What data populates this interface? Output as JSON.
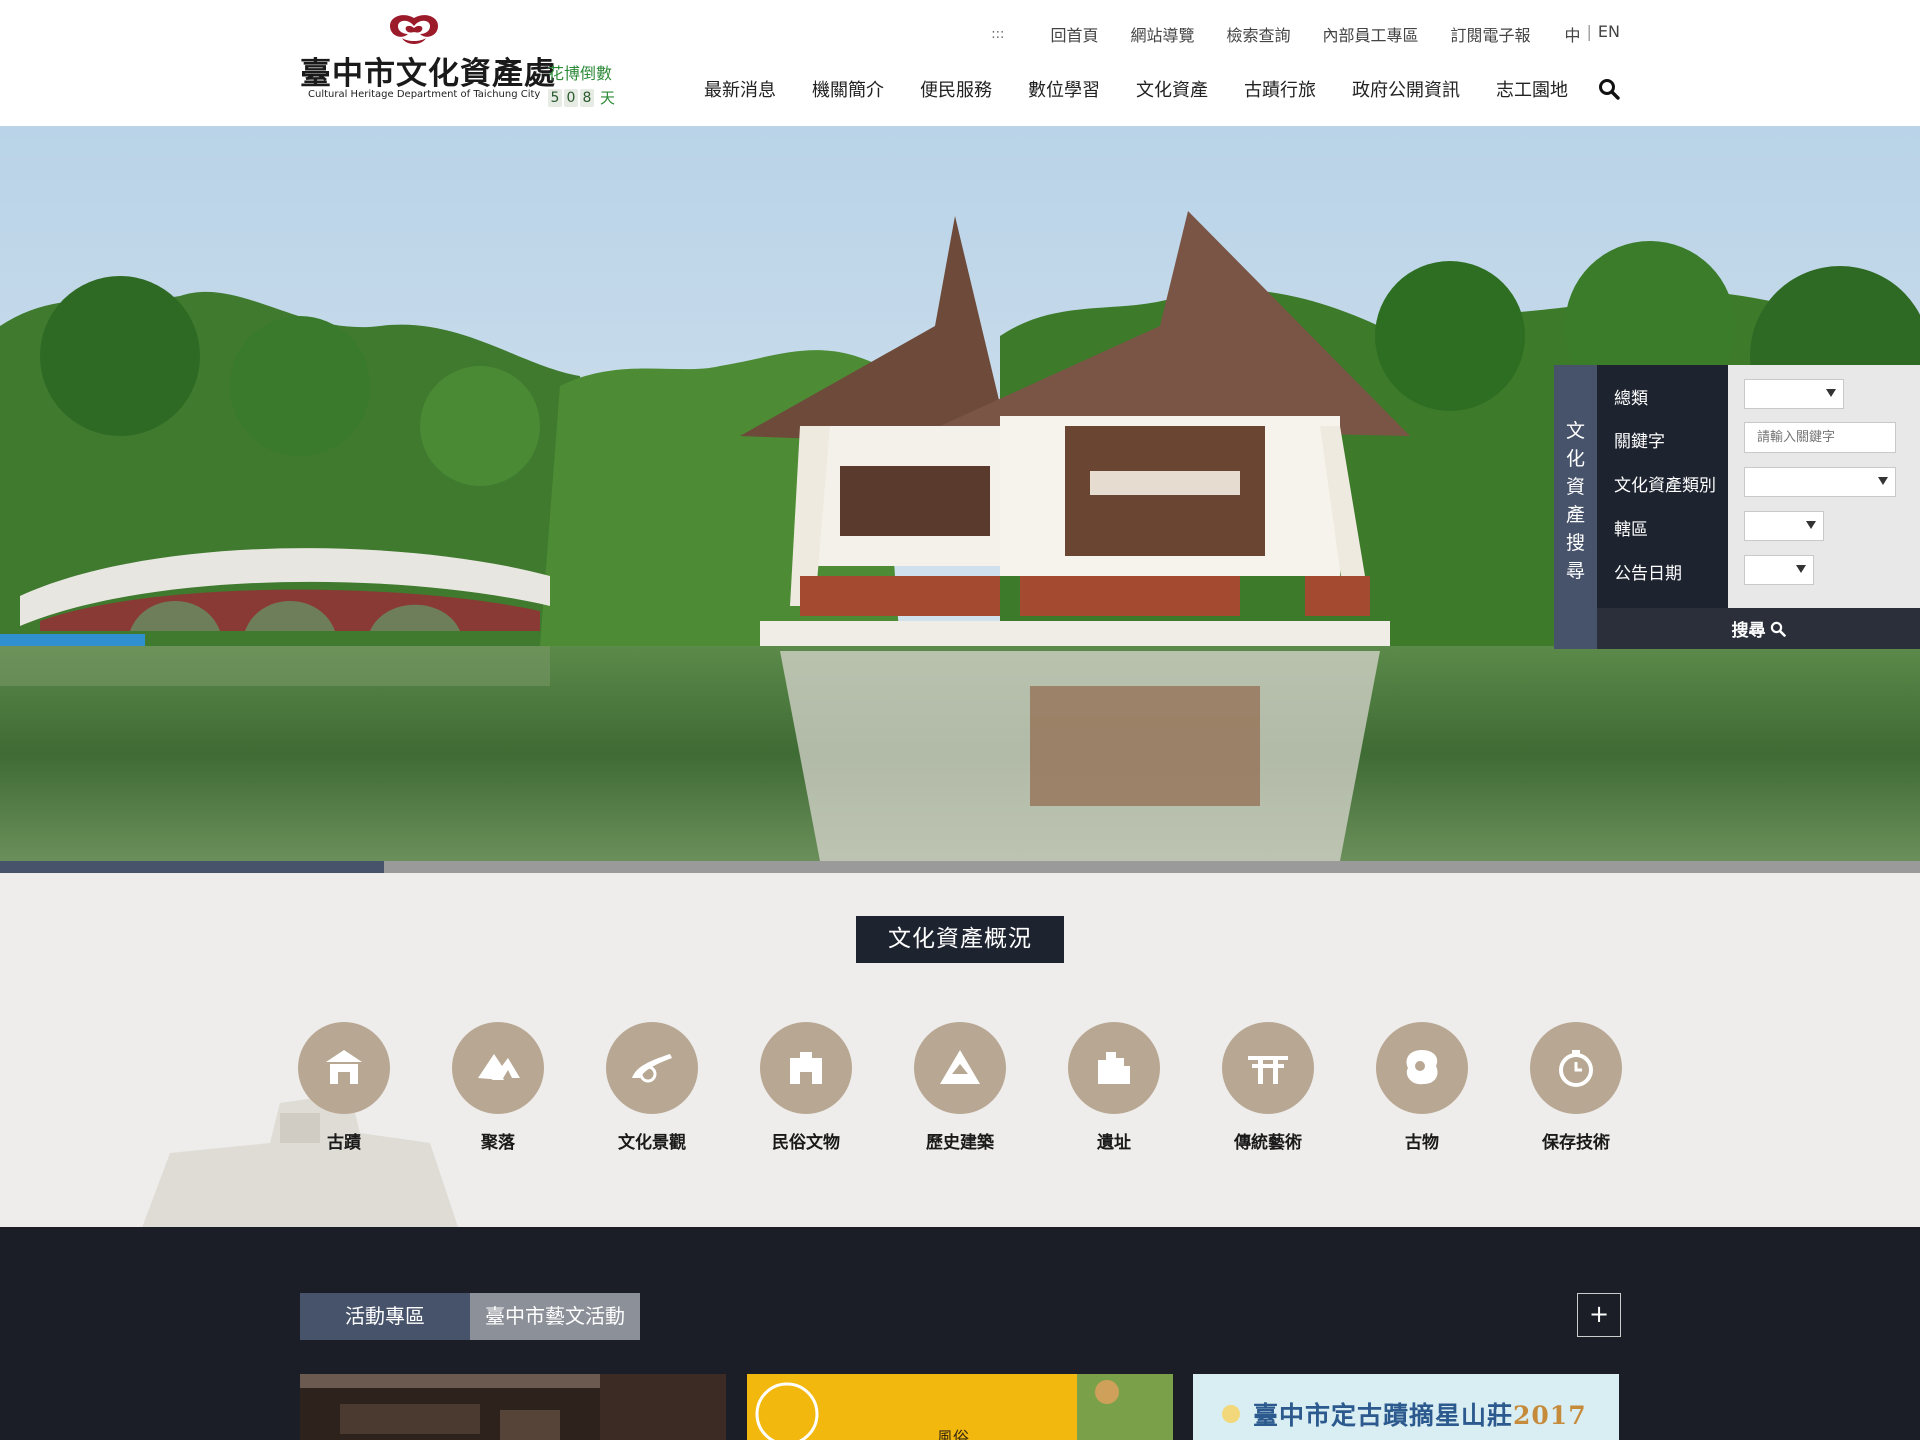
{
  "header": {
    "logo_title": "臺中市文化資產處",
    "logo_subtitle": "Cultural Heritage Department of Taichung City",
    "countdown_label": "花博倒數",
    "countdown_digits": [
      "5",
      "0",
      "8"
    ],
    "countdown_unit": "天"
  },
  "utility_nav": {
    "accessibility_anchor": ":::",
    "items": [
      "回首頁",
      "網站導覽",
      "檢索查詢",
      "內部員工專區",
      "訂閱電子報"
    ],
    "lang_zh": "中",
    "lang_sep": "|",
    "lang_en": "EN"
  },
  "main_nav": {
    "items": [
      "最新消息",
      "機關簡介",
      "便民服務",
      "數位學習",
      "文化資產",
      "古蹟行旅",
      "政府公開資訊",
      "志工園地"
    ]
  },
  "hero": {
    "slider_progress": 0.2
  },
  "search_panel": {
    "tab_chars": [
      "文",
      "化",
      "資",
      "產",
      "搜",
      "尋"
    ],
    "labels": [
      "總類",
      "關鍵字",
      "文化資產類別",
      "轄區",
      "公告日期"
    ],
    "keyword_placeholder": "請輸入關鍵字",
    "button_label": "搜尋"
  },
  "overview": {
    "title": "文化資產概況",
    "categories": [
      "古蹟",
      "聚落",
      "文化景觀",
      "民俗文物",
      "歷史建築",
      "遺址",
      "傳統藝術",
      "古物",
      "保存技術"
    ]
  },
  "activities": {
    "tabs": [
      "活動專區",
      "臺中市藝文活動"
    ],
    "more_label": "+",
    "card2_text": "風俗",
    "card3_text": "臺中市定古蹟摘星山莊",
    "card3_year": "2017"
  },
  "colors": {
    "nav_dark": "#1e2330",
    "accent_slate": "#46536a",
    "category_tan": "#b8a792",
    "brand_red": "#9b1b2a",
    "countdown_green": "#2e8b3a"
  }
}
